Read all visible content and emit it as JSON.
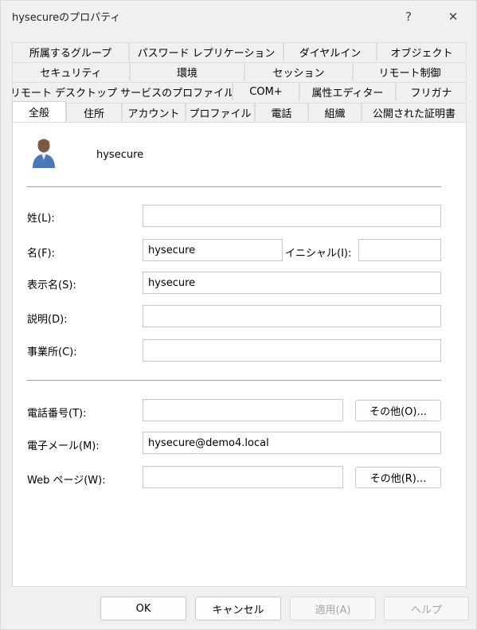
{
  "window": {
    "title": "hysecureのプロパティ",
    "help_glyph": "?",
    "close_glyph": "✕"
  },
  "tabs": {
    "row1": [
      "所属するグループ",
      "パスワード レプリケーション",
      "ダイヤルイン",
      "オブジェクト"
    ],
    "row2": [
      "セキュリティ",
      "環境",
      "セッション",
      "リモート制御"
    ],
    "row3": [
      "リモート デスクトップ サービスのプロファイル",
      "COM+",
      "属性エディター",
      "フリガナ"
    ],
    "row4": [
      "全般",
      "住所",
      "アカウント",
      "プロファイル",
      "電話",
      "組織",
      "公開された証明書"
    ],
    "active": "全般"
  },
  "general": {
    "account_name": "hysecure",
    "last_name_label": "姓(L):",
    "last_name_value": "",
    "first_name_label": "名(F):",
    "first_name_value": "hysecure",
    "initials_label": "イニシャル(I):",
    "initials_value": "",
    "display_name_label": "表示名(S):",
    "display_name_value": "hysecure",
    "description_label": "説明(D):",
    "description_value": "",
    "office_label": "事業所(C):",
    "office_value": "",
    "phone_label": "電話番号(T):",
    "phone_value": "",
    "phone_other_label": "その他(O)...",
    "email_label": "電子メール(M):",
    "email_value": "hysecure@demo4.local",
    "web_label": "Web ページ(W):",
    "web_value": "",
    "web_other_label": "その他(R)..."
  },
  "footer": {
    "ok_label": "OK",
    "cancel_label": "キャンセル",
    "apply_label": "適用(A)",
    "help_label": "ヘルプ"
  }
}
